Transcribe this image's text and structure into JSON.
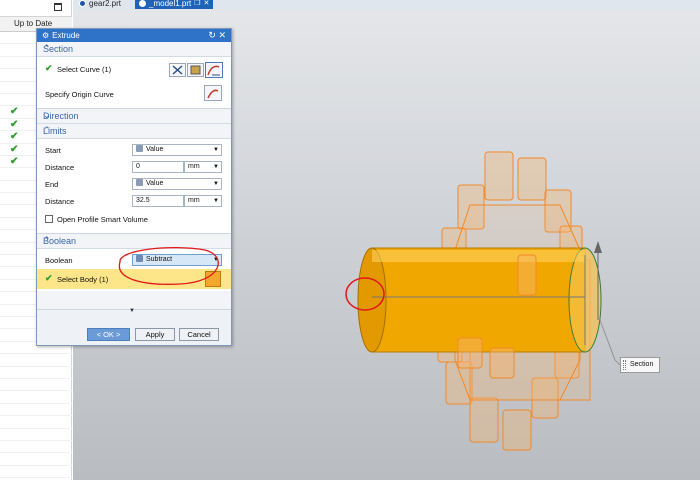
{
  "navigator": {
    "column_header": "Up to Date",
    "checked_rows": [
      6,
      7,
      8,
      9,
      10
    ]
  },
  "tabs": [
    {
      "label": "gear2.prt",
      "active": false
    },
    {
      "label": "_model1.prt",
      "active": true
    }
  ],
  "dialog": {
    "title": "Extrude",
    "section": {
      "header": "Section",
      "select_curve": "Select Curve (1)",
      "specify_origin": "Specify Origin Curve"
    },
    "direction": {
      "header": "Direction"
    },
    "limits": {
      "header": "Limits",
      "start_label": "Start",
      "start_value": "Value",
      "start_distance_label": "Distance",
      "start_distance": "0",
      "start_unit": "mm",
      "end_label": "End",
      "end_value": "Value",
      "end_distance_label": "Distance",
      "end_distance": "32.5",
      "end_unit": "mm",
      "open_profile": "Open Profile Smart Volume"
    },
    "boolean": {
      "header": "Boolean",
      "label": "Boolean",
      "value": "Subtract",
      "select_body": "Select Body (1)"
    },
    "buttons": {
      "ok": "< OK >",
      "apply": "Apply",
      "cancel": "Cancel"
    }
  },
  "callout": {
    "label": "Section"
  },
  "colors": {
    "titlebar": "#2e73c8",
    "section_header": "#3a66a8",
    "highlight_row": "#fde68a",
    "cylinder": "#f0a800",
    "gear_wire": "#f08a2a",
    "annotation": "#e01818"
  }
}
